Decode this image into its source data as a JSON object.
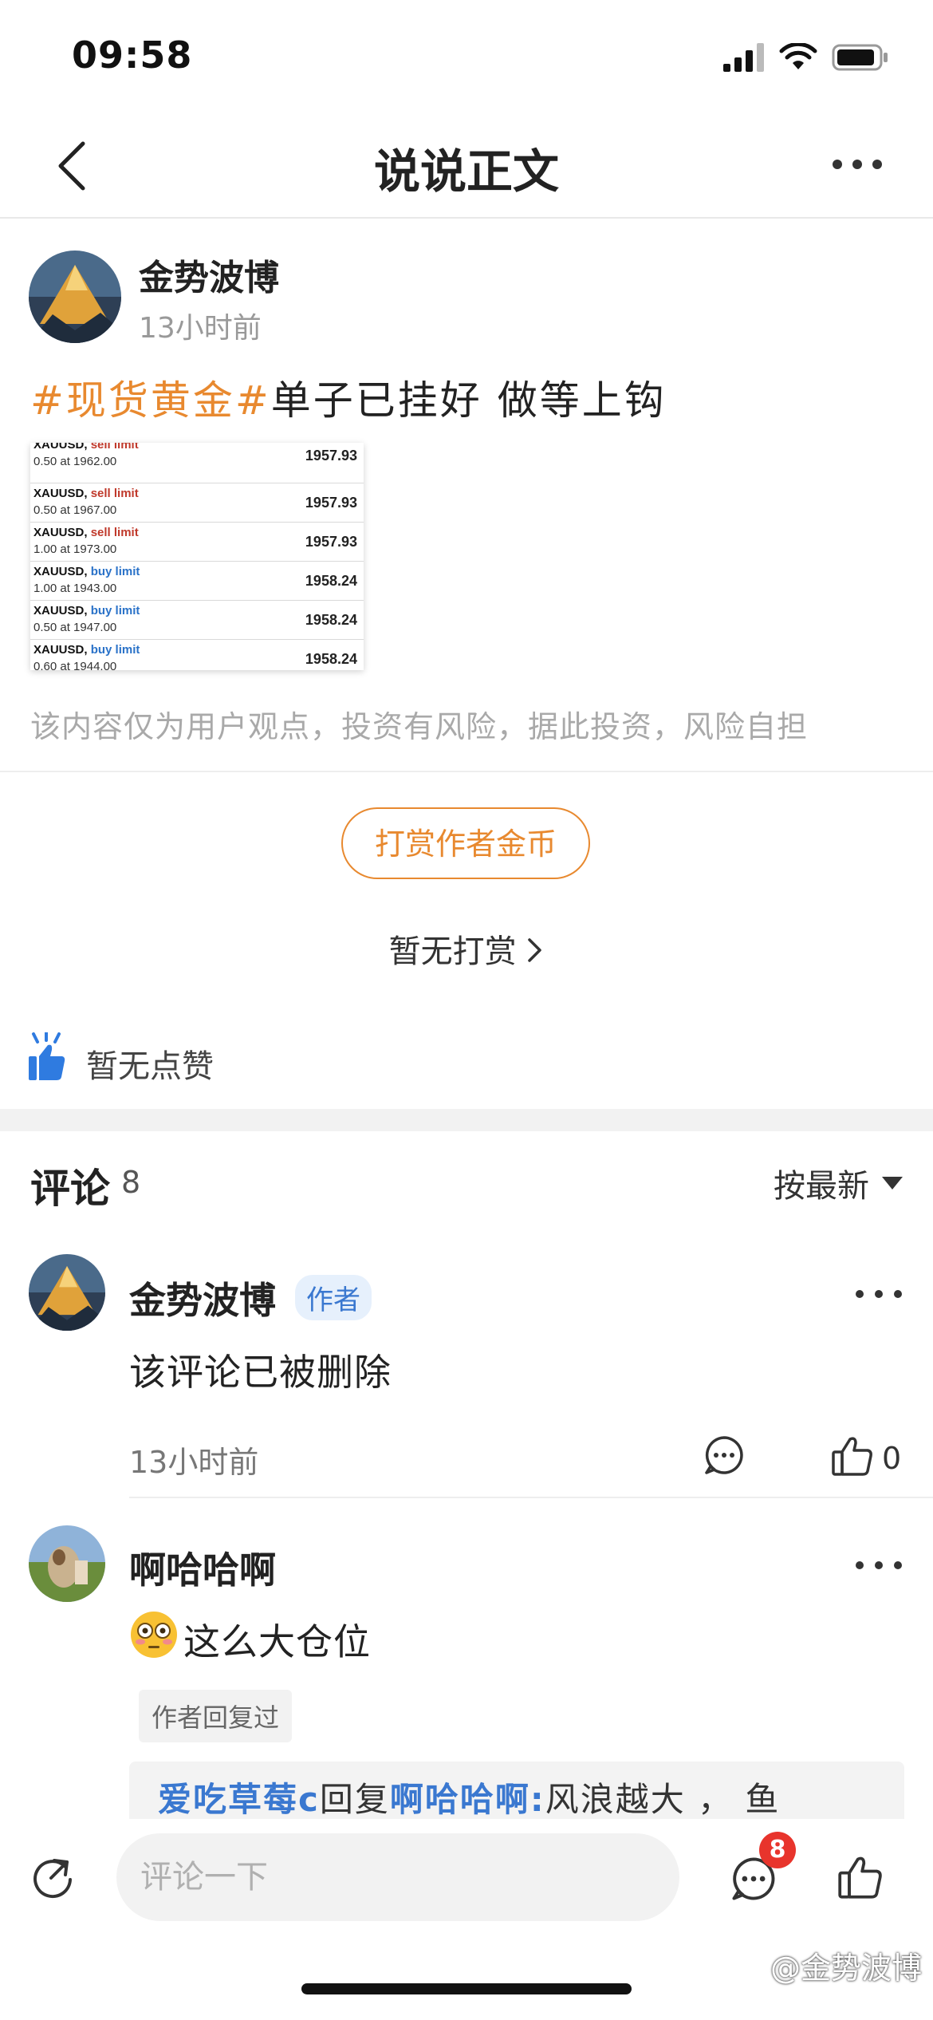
{
  "status": {
    "time": "09:58"
  },
  "nav": {
    "title": "说说正文"
  },
  "post": {
    "author": "金势波博",
    "time_ago": "13小时前",
    "hashtag": "#现货黄金#",
    "text": "单子已挂好 做等上钩",
    "orders": [
      {
        "symbol": "XAUUSD,",
        "type": "sell limit",
        "lot": "0.50 at 1962.00",
        "price": "1957.93"
      },
      {
        "symbol": "XAUUSD,",
        "type": "sell limit",
        "lot": "0.50 at 1967.00",
        "price": "1957.93"
      },
      {
        "symbol": "XAUUSD,",
        "type": "sell limit",
        "lot": "1.00 at 1973.00",
        "price": "1957.93"
      },
      {
        "symbol": "XAUUSD,",
        "type": "buy limit",
        "lot": "1.00 at 1943.00",
        "price": "1958.24"
      },
      {
        "symbol": "XAUUSD,",
        "type": "buy limit",
        "lot": "0.50 at 1947.00",
        "price": "1958.24"
      },
      {
        "symbol": "XAUUSD,",
        "type": "buy limit",
        "lot": "0.60 at 1944.00",
        "price": "1958.24"
      }
    ],
    "disclaimer": "该内容仅为用户观点，投资有风险，据此投资，风险自担"
  },
  "reward": {
    "button": "打赏作者金币",
    "none": "暂无打赏"
  },
  "likes": {
    "none": "暂无点赞"
  },
  "comments": {
    "title": "评论",
    "count": "8",
    "sort": "按最新",
    "items": [
      {
        "name": "金势波博",
        "badge": "作者",
        "text": "该评论已被删除",
        "time": "13小时前",
        "likes": "0"
      },
      {
        "name": "啊哈哈啊",
        "text": "这么大仓位",
        "replied_tag": "作者回复过",
        "reply": {
          "from": "爱吃草莓c",
          "verb": "回复",
          "to": "啊哈哈啊:",
          "text": "风浪越大 ， 鱼"
        }
      }
    ]
  },
  "bottom": {
    "placeholder": "评论一下",
    "comment_badge": "8"
  },
  "watermark": "@金势波博",
  "colors": {
    "accent_orange": "#e8892f",
    "link_blue": "#3a78d0",
    "badge_red": "#e8342c"
  }
}
